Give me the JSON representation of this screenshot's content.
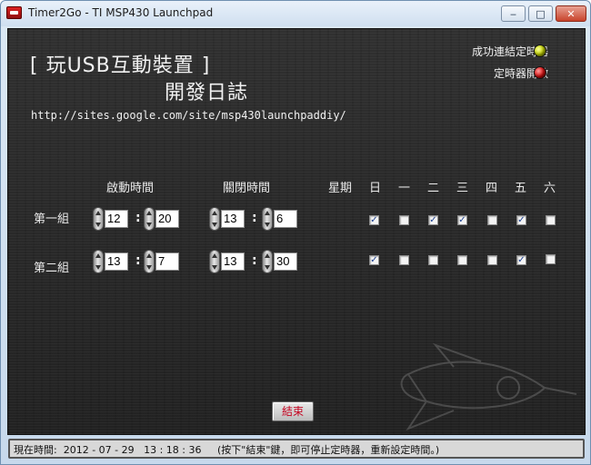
{
  "window": {
    "title": "Timer2Go - TI MSP430 Launchpad",
    "minimize_glyph": "‒",
    "maximize_glyph": "□",
    "close_glyph": "✕"
  },
  "header": {
    "title_line1": "[  玩USB互動裝置  ]",
    "title_line2": "開發日誌",
    "url": "http://sites.google.com/site/msp430launchpaddiy/"
  },
  "indicators": [
    {
      "label": "成功連結定時器",
      "color": "#c9d900",
      "icon": "indicator-led-icon"
    },
    {
      "label": "定時器開啟",
      "color": "#e21010",
      "icon": "indicator-led-icon"
    }
  ],
  "schedule": {
    "headers": {
      "start_time": "啟動時間",
      "stop_time": "關閉時間",
      "weekday": "星期",
      "days": [
        "日",
        "一",
        "二",
        "三",
        "四",
        "五",
        "六"
      ]
    },
    "groups": [
      {
        "label": "第一組",
        "start_hour": "12",
        "start_minute": "20",
        "stop_hour": "13",
        "stop_minute": "6",
        "days_checked": [
          true,
          false,
          true,
          true,
          false,
          true,
          false
        ]
      },
      {
        "label": "第二組",
        "start_hour": "13",
        "start_minute": "7",
        "stop_hour": "13",
        "stop_minute": "30",
        "days_checked": [
          true,
          false,
          false,
          false,
          false,
          true,
          false
        ]
      }
    ],
    "separator": ":"
  },
  "stop_button": {
    "label": "結束"
  },
  "status_bar": {
    "text": "現在時間:  2012 - 07 - 29   13 : 18 : 36     (按下\"結束\"鍵，即可停止定時器，重新設定時間。)"
  },
  "colors": {
    "panel_background": "#2a2a2a",
    "stop_label": "#c4001e",
    "check_mark": "#1b3f8f"
  }
}
